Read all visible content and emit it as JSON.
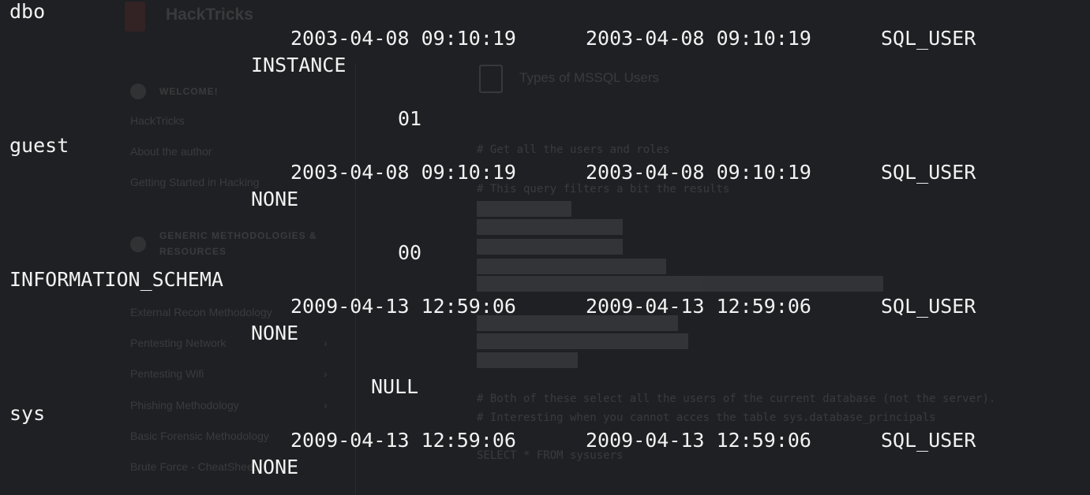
{
  "background_page": {
    "brand": "HackTricks",
    "page_title": "Types of MSSQL Users",
    "sidebar": {
      "sections": [
        {
          "label": "WELCOME!"
        },
        {
          "label": "GENERIC METHODOLOGIES &"
        },
        {
          "label": "RESOURCES"
        }
      ],
      "items": [
        {
          "label": "HackTricks"
        },
        {
          "label": "About the author"
        },
        {
          "label": "Getting Started in Hacking"
        },
        {
          "label": "External Recon Methodology"
        },
        {
          "label": "Pentesting Network"
        },
        {
          "label": "Pentesting Wifi"
        },
        {
          "label": "Phishing Methodology"
        },
        {
          "label": "Basic Forensic Methodology"
        },
        {
          "label": "Brute Force - CheatSheet"
        }
      ],
      "chevron": "›"
    },
    "code_lines": [
      "# Get all the users and roles",
      "# This query filters a bit the results",
      "# Both of these select all the users of the current database (not the server).",
      "# Interesting when you cannot acces the table sys.database_principals",
      "SELECT * FROM sysusers"
    ]
  },
  "terminal": {
    "rows": [
      {
        "name": "dbo",
        "created": "2003-04-08 09:10:19",
        "modified": "2003-04-08 09:10:19",
        "type": "SQL_USER",
        "auth": "INSTANCE",
        "extra": "01"
      },
      {
        "name": "guest",
        "created": "2003-04-08 09:10:19",
        "modified": "2003-04-08 09:10:19",
        "type": "SQL_USER",
        "auth": "NONE",
        "extra": "00"
      },
      {
        "name": "INFORMATION_SCHEMA",
        "created": "2009-04-13 12:59:06",
        "modified": "2009-04-13 12:59:06",
        "type": "SQL_USER",
        "auth": "NONE",
        "extra": "NULL"
      },
      {
        "name": "sys",
        "created": "2009-04-13 12:59:06",
        "modified": "2009-04-13 12:59:06",
        "type": "SQL_USER",
        "auth": "NONE"
      }
    ]
  }
}
